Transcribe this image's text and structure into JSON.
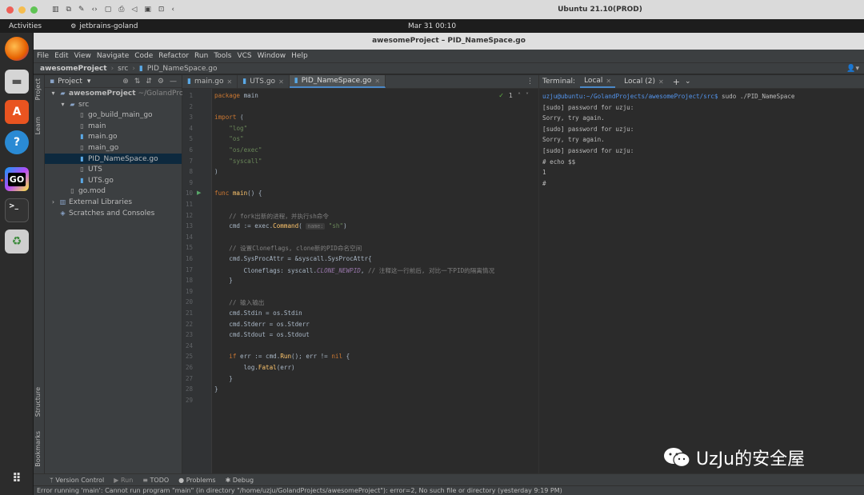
{
  "mac_bar": {
    "window_title": "Ubuntu 21.10(PROD)",
    "traffic_colors": [
      "#ee5f57",
      "#f5bd4f",
      "#5fc454"
    ]
  },
  "gnome_bar": {
    "activities": "Activities",
    "app": "jetbrains-goland",
    "clock": "Mar 31  00:10"
  },
  "dock": {
    "icons": [
      "firefox-icon",
      "files-icon",
      "software-icon",
      "help-icon",
      "goland-icon",
      "terminal-icon",
      "trash-icon",
      "apps-grid-icon"
    ]
  },
  "ide": {
    "title": "awesomeProject – PID_NameSpace.go",
    "menu": [
      "File",
      "Edit",
      "View",
      "Navigate",
      "Code",
      "Refactor",
      "Run",
      "Tools",
      "VCS",
      "Window",
      "Help"
    ],
    "breadcrumb": [
      "awesomeProject",
      "src",
      "PID_NameSpace.go"
    ],
    "side_labels": {
      "project": "Project",
      "learn": "Learn",
      "structure": "Structure",
      "bookmarks": "Bookmarks"
    },
    "project_panel": {
      "title": "Project",
      "tree": [
        {
          "label": "awesomeProject",
          "suffix": "~/GolandProject",
          "indent": 0,
          "icon": "folder",
          "bold": true
        },
        {
          "label": "src",
          "indent": 1,
          "icon": "folder"
        },
        {
          "label": "go_build_main_go",
          "indent": 2,
          "icon": "file"
        },
        {
          "label": "main",
          "indent": 2,
          "icon": "file"
        },
        {
          "label": "main.go",
          "indent": 2,
          "icon": "gofile"
        },
        {
          "label": "main_go",
          "indent": 2,
          "icon": "file"
        },
        {
          "label": "PID_NameSpace.go",
          "indent": 2,
          "icon": "gofile",
          "selected": true
        },
        {
          "label": "UTS",
          "indent": 2,
          "icon": "file"
        },
        {
          "label": "UTS.go",
          "indent": 2,
          "icon": "gofile"
        },
        {
          "label": "go.mod",
          "indent": 1,
          "icon": "file"
        },
        {
          "label": "External Libraries",
          "indent": 0,
          "icon": "lib"
        },
        {
          "label": "Scratches and Consoles",
          "indent": 0,
          "icon": "scratch"
        }
      ]
    },
    "editor": {
      "tabs": [
        {
          "label": "main.go",
          "active": false
        },
        {
          "label": "UTS.go",
          "active": false
        },
        {
          "label": "PID_NameSpace.go",
          "active": true
        }
      ],
      "inspection_count": "1",
      "lines": [
        [
          [
            "kw",
            "package "
          ],
          [
            "pl",
            "main"
          ]
        ],
        [],
        [
          [
            "kw",
            "import "
          ],
          [
            "pl",
            "("
          ]
        ],
        [
          [
            "pl",
            "    "
          ],
          [
            "str",
            "\"log\""
          ]
        ],
        [
          [
            "pl",
            "    "
          ],
          [
            "str",
            "\"os\""
          ]
        ],
        [
          [
            "pl",
            "    "
          ],
          [
            "str",
            "\"os/exec\""
          ]
        ],
        [
          [
            "pl",
            "    "
          ],
          [
            "str",
            "\"syscall\""
          ]
        ],
        [
          [
            "pl",
            ")"
          ]
        ],
        [],
        [
          [
            "kw",
            "func "
          ],
          [
            "fn",
            "main"
          ],
          [
            "pl",
            "() {"
          ]
        ],
        [],
        [
          [
            "pl",
            "    "
          ],
          [
            "cm",
            "// fork出新的进程，并执行sh命令"
          ]
        ],
        [
          [
            "pl",
            "    cmd := exec."
          ],
          [
            "fn",
            "Command"
          ],
          [
            "pl",
            "( "
          ],
          [
            "hint",
            "name:"
          ],
          [
            "pl",
            " "
          ],
          [
            "str",
            "\"sh\""
          ],
          [
            "pl",
            ")"
          ]
        ],
        [],
        [
          [
            "pl",
            "    "
          ],
          [
            "cm",
            "// 设置Cloneflags, clone新的PID命名空间"
          ]
        ],
        [
          [
            "pl",
            "    cmd.SysProcAttr = &syscall."
          ],
          [
            "pl",
            "SysProcAttr{"
          ]
        ],
        [
          [
            "pl",
            "        Cloneflags: syscall."
          ],
          [
            "cn",
            "CLONE_NEWPID"
          ],
          [
            "pl",
            ", "
          ],
          [
            "cm",
            "// 注释这一行前后, 对比一下PID的隔离情况"
          ]
        ],
        [
          [
            "pl",
            "    }"
          ]
        ],
        [],
        [
          [
            "pl",
            "    "
          ],
          [
            "cm",
            "// 输入输出"
          ]
        ],
        [
          [
            "pl",
            "    cmd.Stdin = os.Stdin"
          ]
        ],
        [
          [
            "pl",
            "    cmd.Stderr = os.Stderr"
          ]
        ],
        [
          [
            "pl",
            "    cmd.Stdout = os.Stdout"
          ]
        ],
        [],
        [
          [
            "pl",
            "    "
          ],
          [
            "kw",
            "if "
          ],
          [
            "pl",
            "err := cmd."
          ],
          [
            "fn",
            "Run"
          ],
          [
            "pl",
            "(); err != "
          ],
          [
            "kw",
            "nil"
          ],
          [
            "pl",
            " {"
          ]
        ],
        [
          [
            "pl",
            "        log."
          ],
          [
            "fn",
            "Fatal"
          ],
          [
            "pl",
            "(err)"
          ]
        ],
        [
          [
            "pl",
            "    }"
          ]
        ],
        [
          [
            "pl",
            "}"
          ]
        ],
        []
      ]
    },
    "terminal": {
      "label": "Terminal:",
      "tabs": [
        {
          "label": "Local",
          "active": true
        },
        {
          "label": "Local (2)",
          "active": false
        }
      ],
      "prompt_user": "uzju@ubuntu",
      "prompt_path": ":~/GolandProjects/awesomeProject/src$",
      "command": " sudo ./PID_NameSpace",
      "output": [
        "[sudo] password for uzju:",
        "Sorry, try again.",
        "[sudo] password for uzju:",
        "Sorry, try again.",
        "[sudo] password for uzju:",
        "# echo $$",
        "1",
        "#"
      ]
    },
    "bottom_tools": [
      "Version Control",
      "Run",
      "TODO",
      "Problems",
      "Debug"
    ],
    "status": "Error running 'main': Cannot run program \"main\" (in directory \"/home/uzju/GolandProjects/awesomeProject\"): error=2, No such file or directory (yesterday 9:19 PM)"
  },
  "watermark": {
    "text": "UzJu的安全屋"
  }
}
